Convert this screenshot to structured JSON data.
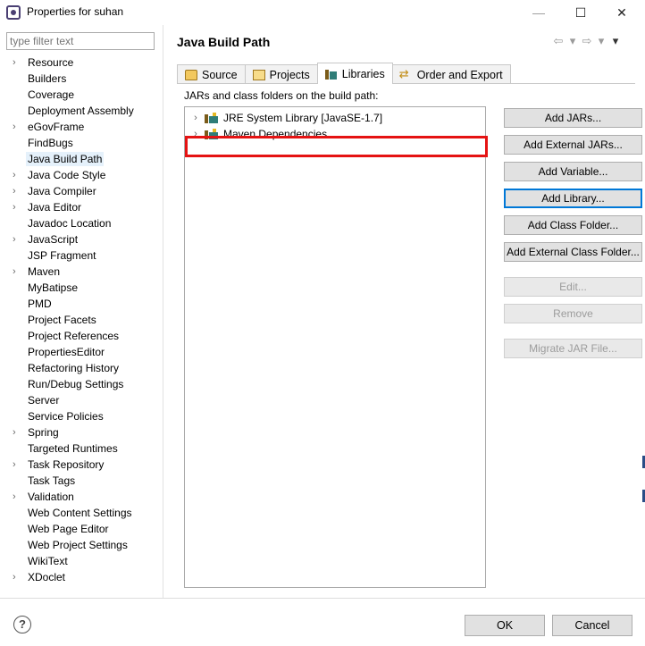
{
  "window": {
    "title": "Properties for suhan",
    "min_glyph": "—",
    "max_glyph": "☐",
    "close_glyph": "✕"
  },
  "filter": {
    "placeholder": "type filter text",
    "value": ""
  },
  "nav": {
    "items": [
      {
        "label": "Resource",
        "expandable": true
      },
      {
        "label": "Builders",
        "expandable": false
      },
      {
        "label": "Coverage",
        "expandable": false
      },
      {
        "label": "Deployment Assembly",
        "expandable": false
      },
      {
        "label": "eGovFrame",
        "expandable": true
      },
      {
        "label": "FindBugs",
        "expandable": false
      },
      {
        "label": "Java Build Path",
        "expandable": false,
        "selected": true
      },
      {
        "label": "Java Code Style",
        "expandable": true
      },
      {
        "label": "Java Compiler",
        "expandable": true
      },
      {
        "label": "Java Editor",
        "expandable": true
      },
      {
        "label": "Javadoc Location",
        "expandable": false
      },
      {
        "label": "JavaScript",
        "expandable": true
      },
      {
        "label": "JSP Fragment",
        "expandable": false
      },
      {
        "label": "Maven",
        "expandable": true
      },
      {
        "label": "MyBatipse",
        "expandable": false
      },
      {
        "label": "PMD",
        "expandable": false
      },
      {
        "label": "Project Facets",
        "expandable": false
      },
      {
        "label": "Project References",
        "expandable": false
      },
      {
        "label": "PropertiesEditor",
        "expandable": false
      },
      {
        "label": "Refactoring History",
        "expandable": false
      },
      {
        "label": "Run/Debug Settings",
        "expandable": false
      },
      {
        "label": "Server",
        "expandable": false
      },
      {
        "label": "Service Policies",
        "expandable": false
      },
      {
        "label": "Spring",
        "expandable": true
      },
      {
        "label": "Targeted Runtimes",
        "expandable": false
      },
      {
        "label": "Task Repository",
        "expandable": true
      },
      {
        "label": "Task Tags",
        "expandable": false
      },
      {
        "label": "Validation",
        "expandable": true
      },
      {
        "label": "Web Content Settings",
        "expandable": false
      },
      {
        "label": "Web Page Editor",
        "expandable": false
      },
      {
        "label": "Web Project Settings",
        "expandable": false
      },
      {
        "label": "WikiText",
        "expandable": false
      },
      {
        "label": "XDoclet",
        "expandable": true
      }
    ]
  },
  "page": {
    "title": "Java Build Path",
    "tabs": [
      {
        "label": "Source",
        "icon": "source-folder-icon"
      },
      {
        "label": "Projects",
        "icon": "projects-folder-icon"
      },
      {
        "label": "Libraries",
        "icon": "libraries-icon",
        "active": true
      },
      {
        "label": "Order and Export",
        "icon": "order-export-icon"
      }
    ],
    "section_label": "JARs and class folders on the build path:",
    "libraries": [
      {
        "label": "JRE System Library [JavaSE-1.7]"
      },
      {
        "label": "Maven Dependencies"
      }
    ],
    "buttons": {
      "add_jars": "Add JARs...",
      "add_external_jars": "Add External JARs...",
      "add_variable": "Add Variable...",
      "add_library": "Add Library...",
      "add_class_folder": "Add Class Folder...",
      "add_external_class_folder": "Add External Class Folder...",
      "edit": "Edit...",
      "remove": "Remove",
      "migrate_jar": "Migrate JAR File..."
    }
  },
  "footer": {
    "help_glyph": "?",
    "ok": "OK",
    "cancel": "Cancel"
  },
  "colors": {
    "highlight": "#e51313",
    "selection": "#e5f1fb",
    "default_button_border": "#0078d7"
  }
}
